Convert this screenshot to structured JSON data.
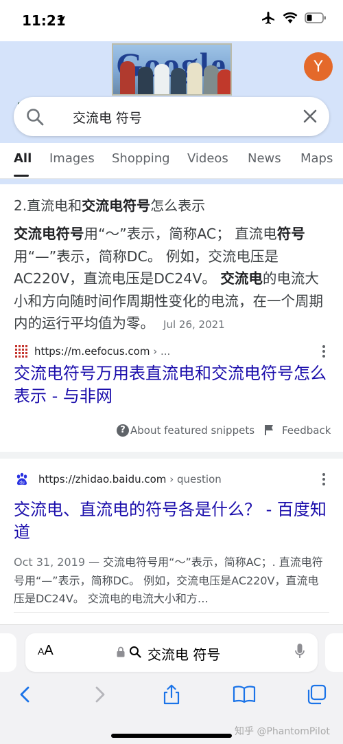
{
  "status_bar": {
    "time": "11:21"
  },
  "header": {
    "avatar_letter": "Y",
    "doodle_text": "Google"
  },
  "search": {
    "query": "交流电 符号"
  },
  "tabs": [
    {
      "label": "All",
      "active": true
    },
    {
      "label": "Images"
    },
    {
      "label": "Shopping"
    },
    {
      "label": "Videos"
    },
    {
      "label": "News"
    },
    {
      "label": "Maps"
    }
  ],
  "featured": {
    "heading_prefix": "2.直流电和",
    "heading_bold": "交流电符号",
    "heading_suffix": "怎么表示",
    "b1": "交流电符号",
    "t1": "用“～”表示，简称AC； 直流电",
    "b2": "符号",
    "t2": "用“—”表示，简称DC。 例如，交流电压是AC220V，直流电压是DC24V。 ",
    "b3": "交流电",
    "t3": "的电流大小和方向随时间作周期性变化的电流，在一个周期内的运行平均值为零。",
    "date": "Jul 26, 2021",
    "source_url": "https://m.eefocus.com",
    "source_path": " › ...",
    "title": "交流电符号万用表直流电和交流电符号怎么表示 - 与非网",
    "about_label": "About featured snippets",
    "feedback_label": "Feedback"
  },
  "result2": {
    "source_url": "https://zhidao.baidu.com",
    "source_path": " › question",
    "title": "交流电、直流电的符号各是什么？ - 百度知道",
    "date": "Oct 31, 2019",
    "snippet": " — 交流电符号用“～”表示，简称AC；. 直流电符号用“—”表示，简称DC。 例如，交流电压是AC220V，直流电压是DC24V。 交流电的电流大小和方…"
  },
  "safari": {
    "aa_small": "A",
    "aa_big": "A",
    "address_text": "交流电 符号",
    "watermark": "知乎 @PhantomPilot"
  },
  "colors": {
    "link": "#1a0dab",
    "header_bg": "#d5e3fa",
    "avatar": "#e4692a"
  }
}
